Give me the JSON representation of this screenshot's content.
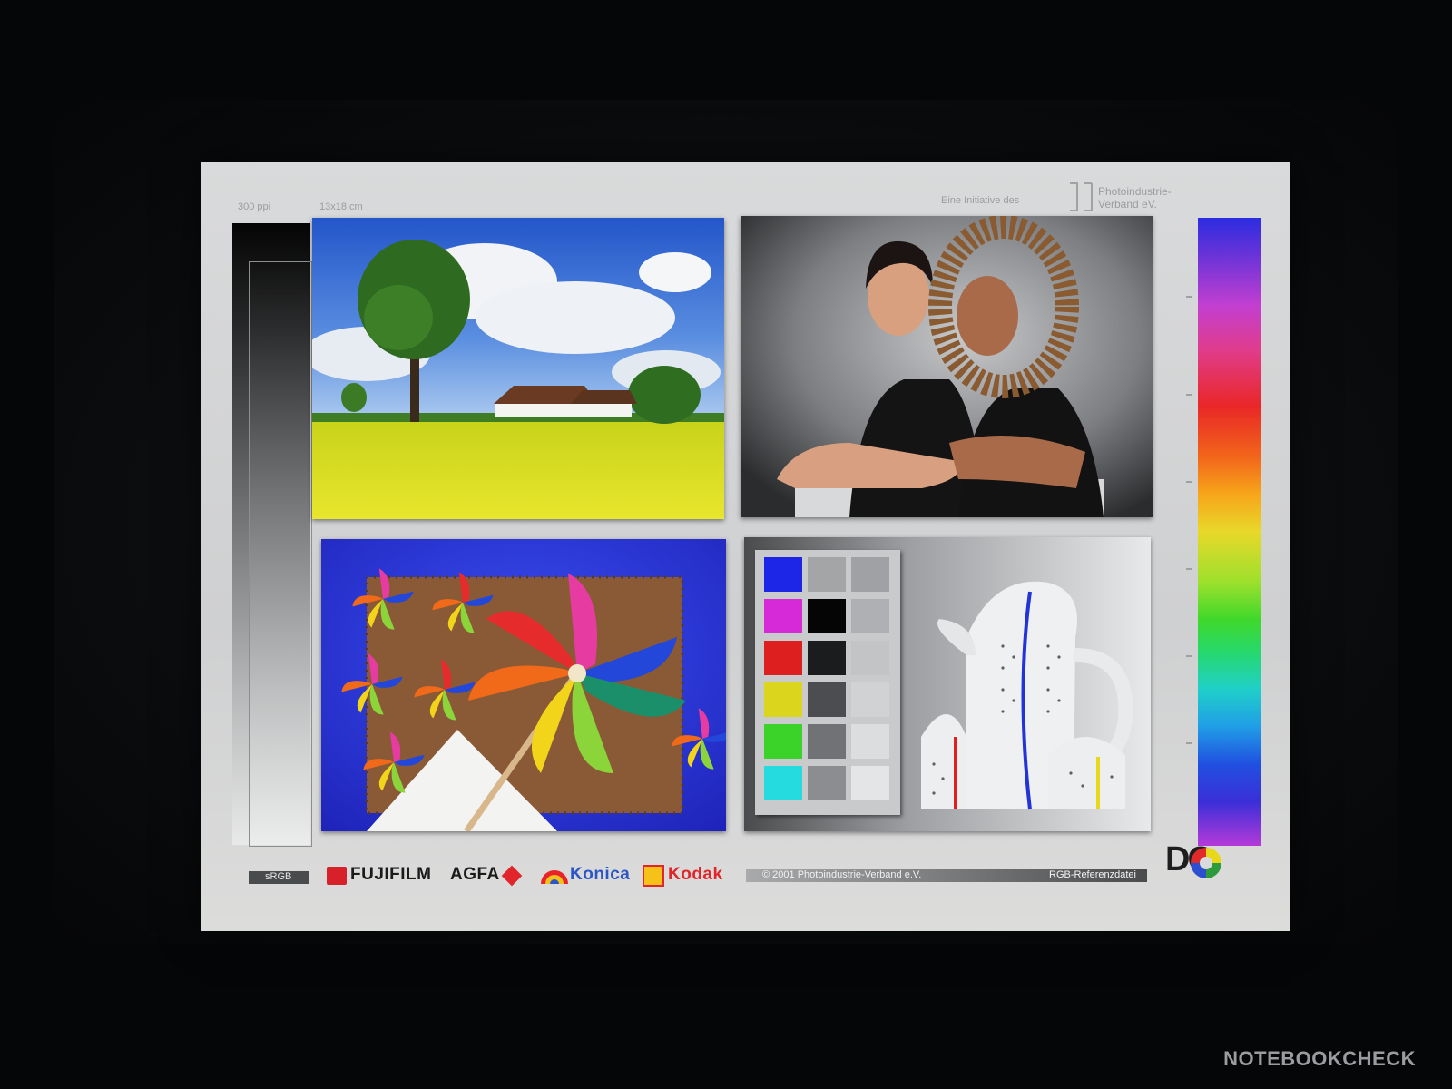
{
  "chart": {
    "resolution_label": "300 ppi",
    "size_label": "13x18 cm",
    "initiative_label": "Eine Initiative des",
    "org_line1": "Photoindustrie-",
    "org_line2": "Verband eV.",
    "colorspace_label": "sRGB",
    "copyright": "© 2001 Photoindustrie-Verband e.V.",
    "reference_label": "RGB-Referenzdatei",
    "brands": [
      "FUJIFILM",
      "AGFA",
      "Konica",
      "Kodak"
    ],
    "corner_logo": "DQ"
  },
  "photos": {
    "landscape": "landscape-photo",
    "portrait": "portrait-photo",
    "pinwheels": "pinwheel-photo",
    "teapot": "teapot-photo"
  },
  "patches": {
    "colors": [
      "#1d25e6",
      "#d62ad9",
      "#dd1f1f",
      "#dcd51e",
      "#3bd22a",
      "#25dbe0"
    ],
    "grays_dark": [
      "#a4a5a7",
      "#050505",
      "#1b1c1d",
      "#4b4d50",
      "#707275",
      "#8b8d90"
    ],
    "grays_light": [
      "#9fa1a4",
      "#aeb0b3",
      "#c2c4c6",
      "#d1d2d4",
      "#dcdddf",
      "#e4e5e6"
    ]
  },
  "watermark": "NOTEBOOKCHECK",
  "colors": {
    "background": "#050607",
    "chart_paper": "#d5d6d7",
    "kodak_red": "#e1262b",
    "konica_blue": "#2c55c7",
    "fuji_red": "#d8202a"
  }
}
